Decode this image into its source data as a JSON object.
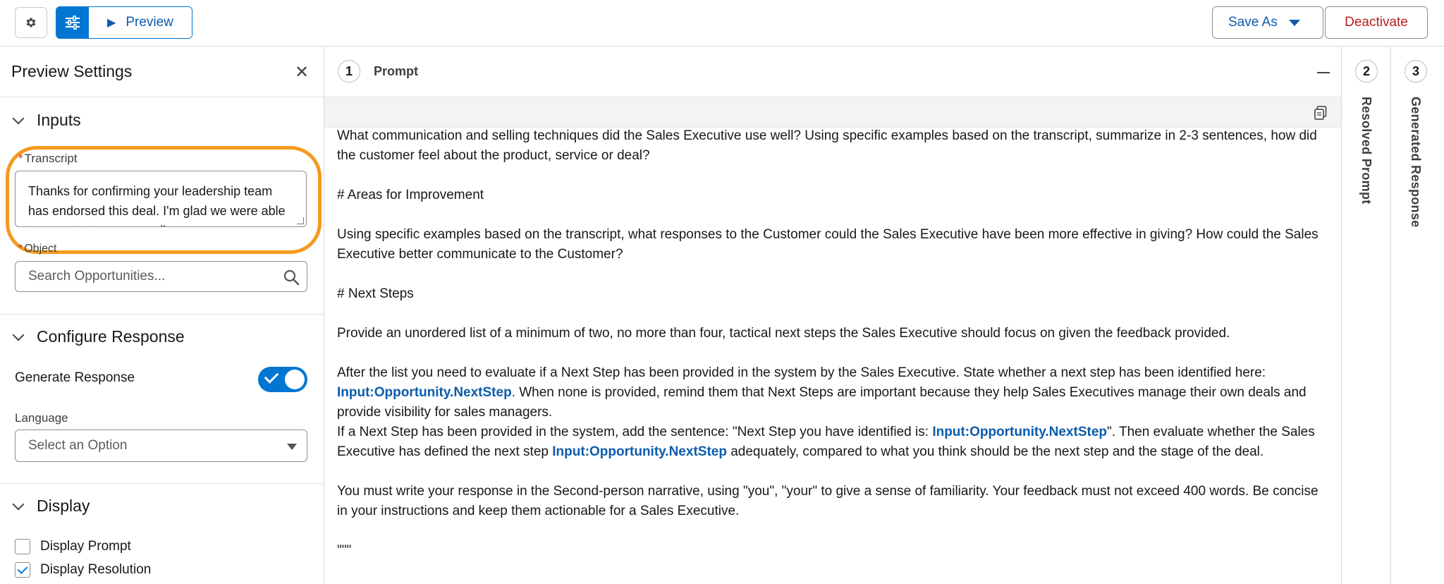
{
  "toolbar": {
    "preview_label": "Preview",
    "save_as_label": "Save As",
    "deactivate_label": "Deactivate"
  },
  "preview_settings": {
    "title": "Preview Settings",
    "inputs": {
      "heading": "Inputs",
      "transcript_label": "Transcript",
      "transcript_value": "Thanks for confirming your leadership team has endorsed this deal. I'm glad we were able to come to terms regarding a",
      "object_label": "Object",
      "object_placeholder": "Search Opportunities..."
    },
    "configure_response": {
      "heading": "Configure Response",
      "generate_response_label": "Generate Response",
      "generate_response_on": true,
      "language_label": "Language",
      "language_value": "Select an Option"
    },
    "display": {
      "heading": "Display",
      "options": [
        {
          "label": "Display Prompt",
          "checked": false
        },
        {
          "label": "Display Resolution",
          "checked": true
        }
      ]
    }
  },
  "prompt_panel": {
    "step": "1",
    "title": "Prompt",
    "p1": "What communication and selling techniques did the Sales Executive use well? Using specific examples based on the transcript, summarize in 2-3 sentences, how did the customer feel about the product, service or deal?",
    "h_improvement": "# Areas for Improvement",
    "p2": "Using specific examples based on the transcript, what responses to the Customer could the Sales Executive have been more effective in giving? How could the Sales Executive better communicate to the Customer?",
    "h_next": "# Next Steps",
    "p3": "Provide an unordered list of a minimum of two, no more than four, tactical next steps the Sales Executive should focus on given the feedback provided.",
    "p4_a": "After the list you need to evaluate if a Next Step has been provided in the system by the Sales Executive. State whether a next step has been identified here: ",
    "merge_field": "Input:Opportunity.NextStep",
    "p4_b": ". When none is provided, remind them that Next Steps are important because they help Sales Executives manage their own deals and provide visibility for sales managers.",
    "p5_a": "If a Next Step has been provided in the system, add the sentence: \"Next Step you have identified is: ",
    "p5_b": "\".  Then evaluate whether the Sales Executive has defined the next step ",
    "p5_c": " adequately, compared to what you think should be the next step and the stage of the deal.",
    "p6": "You must write your response in the Second-person narrative, using \"you\", \"your\" to give a sense of familiarity.  Your feedback must not exceed 400 words. Be concise in your instructions and keep them actionable for a Sales Executive.",
    "p7": "\"\"\""
  },
  "side_panels": [
    {
      "step": "2",
      "label": "Resolved Prompt"
    },
    {
      "step": "3",
      "label": "Generated Response"
    }
  ],
  "colors": {
    "brand_blue": "#0176d3",
    "link_blue": "#0b5cab",
    "destructive_red": "#b61d1d",
    "highlight_orange": "#f39a1e"
  }
}
